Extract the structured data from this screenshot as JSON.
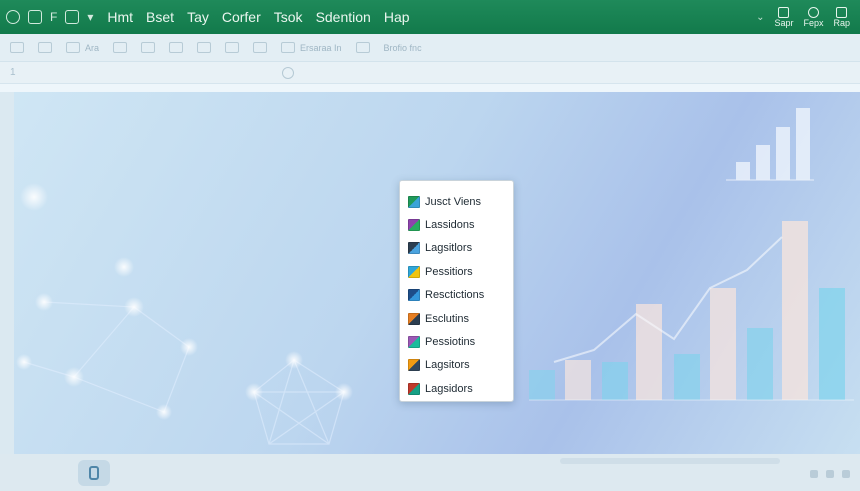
{
  "titlebar": {
    "quick_access": [
      "F"
    ],
    "menu": [
      "Hmt",
      "Bset",
      "Tay",
      "Corfer",
      "Tsok",
      "Sdention",
      "Hap"
    ],
    "right_icons": [
      {
        "icon": "pen-icon",
        "label": "Sapr"
      },
      {
        "icon": "person-icon",
        "label": "Fepx"
      },
      {
        "icon": "gift-icon",
        "label": "Rap"
      }
    ]
  },
  "ribbon": {
    "groups": [
      "Ara",
      "Ersaraa In",
      "Brofio fnc"
    ]
  },
  "formula_bar": {
    "cell_ref": "1"
  },
  "popup": {
    "items": [
      {
        "label": "Jusct Viens",
        "icon": "grid-chart-icon",
        "c1": "#1f9a5a",
        "c2": "#3aa3d8"
      },
      {
        "label": "Lassidons",
        "icon": "bar-chart-icon",
        "c1": "#8e44ad",
        "c2": "#27ae60"
      },
      {
        "label": "Lagsitlors",
        "icon": "line-chart-icon",
        "c1": "#2c3e50",
        "c2": "#4aa3df"
      },
      {
        "label": "Pessitiors",
        "icon": "area-chart-icon",
        "c1": "#2fa7d9",
        "c2": "#f1c40f"
      },
      {
        "label": "Resctictions",
        "icon": "trend-chart-icon",
        "c1": "#1d4e89",
        "c2": "#3498db"
      },
      {
        "label": "Esclutins",
        "icon": "combo-chart-icon",
        "c1": "#e67e22",
        "c2": "#2c3e50"
      },
      {
        "label": "Pessiotins",
        "icon": "striped-chart-icon",
        "c1": "#9b59b6",
        "c2": "#1abc9c"
      },
      {
        "label": "Lagsitors",
        "icon": "pivot-chart-icon",
        "c1": "#f39c12",
        "c2": "#34495e"
      },
      {
        "label": "Lagsidors",
        "icon": "stacked-chart-icon",
        "c1": "#c0392b",
        "c2": "#16a085"
      }
    ]
  },
  "colors": {
    "title_green": "#127a4b",
    "bar_cyan": "#7fd3ec",
    "bar_peach": "#f4e3de"
  }
}
